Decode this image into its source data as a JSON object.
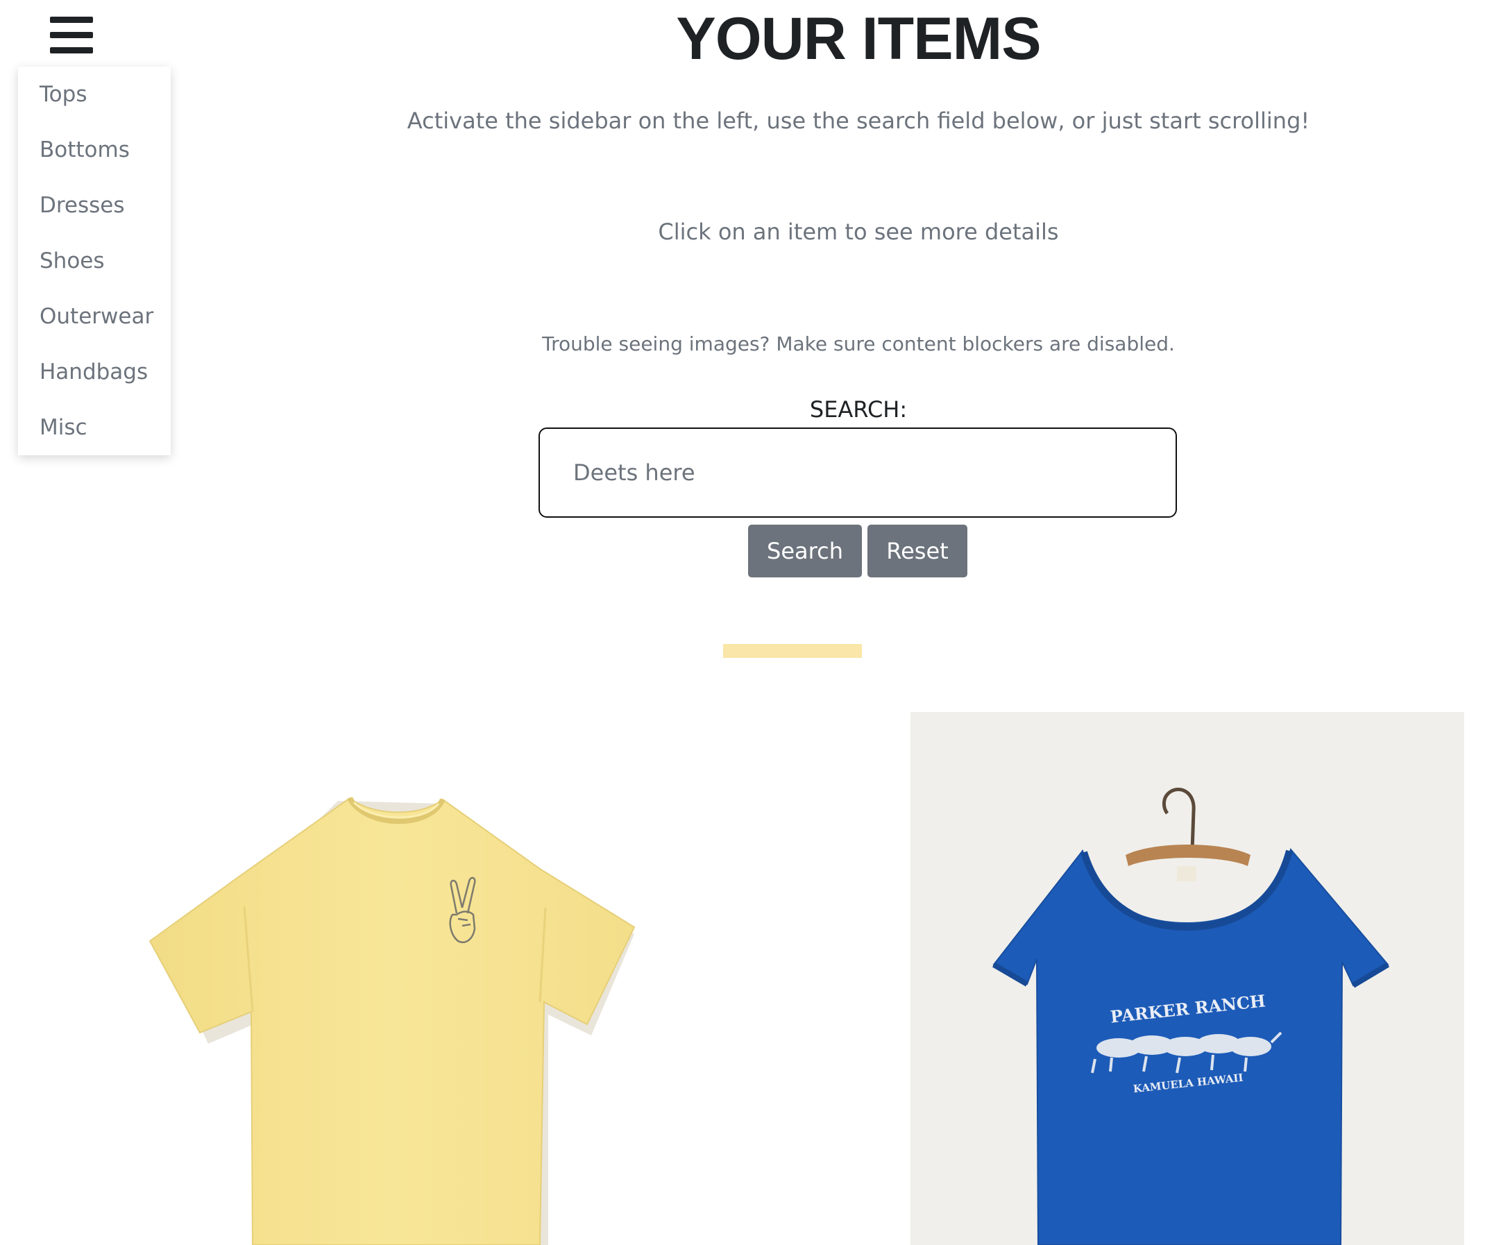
{
  "menu": {
    "icon": "hamburger-menu-icon"
  },
  "sidebar": {
    "items": [
      {
        "label": "Tops"
      },
      {
        "label": "Bottoms"
      },
      {
        "label": "Dresses"
      },
      {
        "label": "Shoes"
      },
      {
        "label": "Outerwear"
      },
      {
        "label": "Handbags"
      },
      {
        "label": "Misc"
      }
    ]
  },
  "header": {
    "title": "YOUR ITEMS",
    "subtitle": "Activate the sidebar on the left, use the search field below, or just start scrolling!",
    "hint": "Click on an item to see more details",
    "notice": "Trouble seeing images? Make sure content blockers are disabled."
  },
  "search": {
    "label": "SEARCH:",
    "placeholder": "Deets here",
    "value": "",
    "search_button": "Search",
    "reset_button": "Reset"
  },
  "items": [
    {
      "image": "yellow-tshirt-peace-sign"
    },
    {
      "image": "blue-tshirt-parker-ranch",
      "print_top": "PARKER RANCH",
      "print_bottom": "KAMUELA HAWAII"
    }
  ],
  "colors": {
    "text": "#6c737c",
    "title": "#1f2225",
    "button": "#6c737c",
    "accent_divider": "#f9e6a8",
    "yellow_shirt": "#f7e494",
    "blue_shirt": "#1d5bb8"
  }
}
